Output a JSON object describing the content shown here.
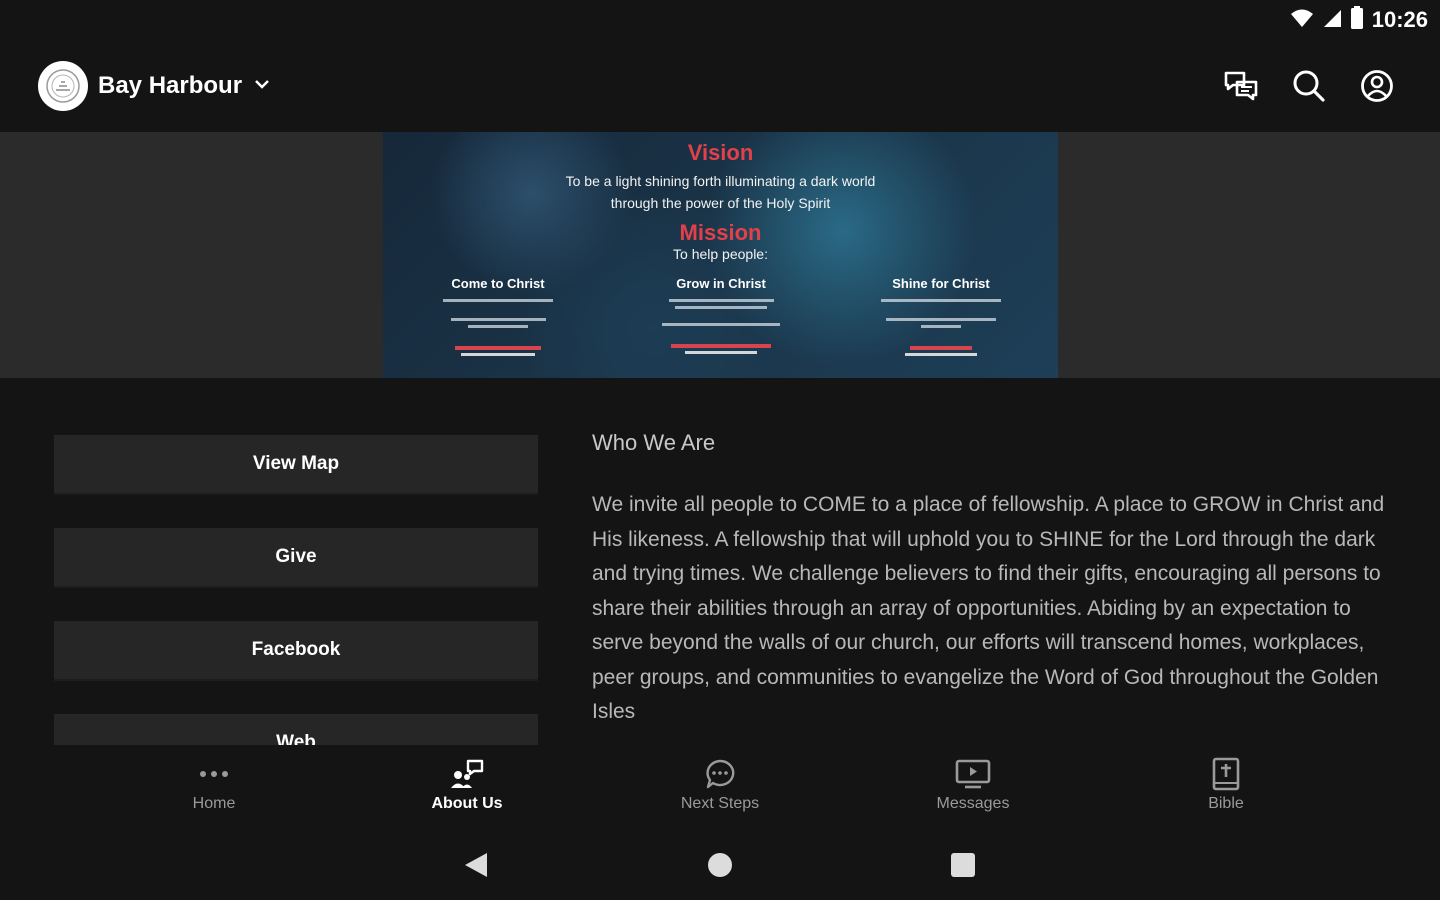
{
  "status_bar": {
    "time": "10:26",
    "icons": [
      "wifi-icon",
      "cell-signal-icon",
      "battery-icon"
    ]
  },
  "header": {
    "church_name": "Bay Harbour",
    "actions": [
      "chat-icon",
      "search-icon",
      "account-icon"
    ]
  },
  "hero": {
    "vision_title": "Vision",
    "vision_line1": "To be a light shining forth illuminating a dark world",
    "vision_line2": "through the power of the Holy Spirit",
    "mission_title": "Mission",
    "mission_sub": "To help people:",
    "columns": [
      {
        "title": "Come to Christ"
      },
      {
        "title": "Grow in Christ"
      },
      {
        "title": "Shine for Christ"
      }
    ]
  },
  "links": {
    "view_map": "View Map",
    "give": "Give",
    "facebook": "Facebook",
    "web": "Web"
  },
  "about": {
    "heading": "Who We Are",
    "body": "We invite all people to COME to a place of fellowship. A place to GROW in Christ and His likeness. A fellowship that will uphold you to SHINE for the Lord through the dark and trying times. We challenge believers to find their gifts, encouraging all persons to share their abilities through an array of opportunities. Abiding by an expectation to serve beyond the walls of our church, our efforts will transcend homes, workplaces, peer groups, and communities to evangelize the Word of God throughout the Golden Isles"
  },
  "tabs": [
    {
      "label": "Home",
      "icon": "more-dots-icon",
      "active": false
    },
    {
      "label": "About Us",
      "icon": "about-people-icon",
      "active": true
    },
    {
      "label": "Next Steps",
      "icon": "chat-bubble-icon",
      "active": false
    },
    {
      "label": "Messages",
      "icon": "tv-play-icon",
      "active": false
    },
    {
      "label": "Bible",
      "icon": "bible-icon",
      "active": false
    }
  ],
  "system_nav": [
    "back-icon",
    "home-circle-icon",
    "recents-icon"
  ],
  "colors": {
    "background": "#141414",
    "button": "#262626",
    "accent_red": "#e4404a"
  }
}
